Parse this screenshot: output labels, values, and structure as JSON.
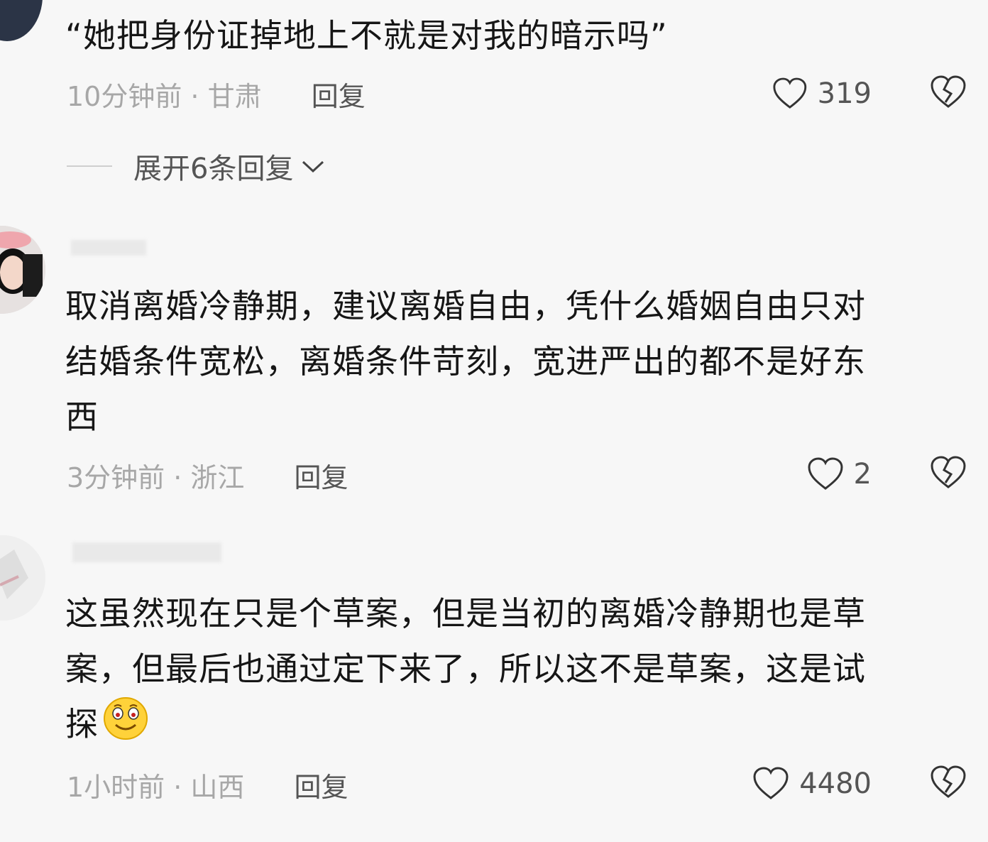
{
  "comments": [
    {
      "text": "“她把身份证掉地上不就是对我的暗示吗”",
      "time_location": "10分钟前 · 甘肃",
      "reply_label": "回复",
      "likes": "319",
      "expand_label": "展开6条回复"
    },
    {
      "lines": [
        "取消离婚冷静期，建议离婚自由，凭什么婚姻自由只对",
        "结婚条件宽松，离婚条件苛刻，宽进严出的都不是好东",
        "西"
      ],
      "time_location": "3分钟前 · 浙江",
      "reply_label": "回复",
      "likes": "2"
    },
    {
      "lines": [
        "这虽然现在只是个草案，但是当初的离婚冷静期也是草",
        "案，但最后也通过定下来了，所以这不是草案，这是试",
        "探"
      ],
      "emoji": "smile-emoji",
      "time_location": "1小时前 · 山西",
      "reply_label": "回复",
      "likes": "4480"
    }
  ],
  "colors": {
    "background": "#f7f7f7",
    "text": "#161616",
    "meta": "#9a9a9a",
    "icon": "#333333"
  }
}
